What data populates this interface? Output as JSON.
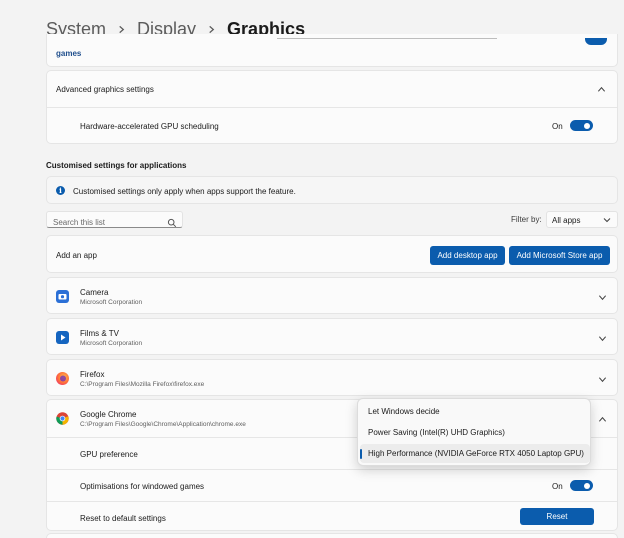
{
  "breadcrumb": {
    "items": [
      "System",
      "Display"
    ],
    "current": "Graphics"
  },
  "top_card": {
    "text": "games"
  },
  "advanced": {
    "title": "Advanced graphics settings",
    "gpu_scheduling_label": "Hardware-accelerated GPU scheduling",
    "gpu_scheduling_state": "On",
    "gpu_scheduling_enabled": true
  },
  "custom": {
    "section_title": "Customised settings for applications",
    "info_text": "Customised settings only apply when apps support the feature."
  },
  "search": {
    "placeholder": "Search this list"
  },
  "filter": {
    "label": "Filter by:",
    "value": "All apps"
  },
  "add_app": {
    "label": "Add an app",
    "desktop_button": "Add desktop app",
    "store_button": "Add Microsoft Store app"
  },
  "apps": [
    {
      "name": "Camera",
      "publisher": "Microsoft Corporation",
      "icon": "camera-icon"
    },
    {
      "name": "Films & TV",
      "publisher": "Microsoft Corporation",
      "icon": "films-tv-icon"
    },
    {
      "name": "Firefox",
      "publisher": "C:\\Program Files\\Mozilla Firefox\\firefox.exe",
      "icon": "firefox-icon"
    },
    {
      "name": "Google Chrome",
      "publisher": "C:\\Program Files\\Google\\Chrome\\Application\\chrome.exe",
      "icon": "chrome-icon"
    }
  ],
  "chrome_settings": {
    "gpu_pref_label": "GPU preference",
    "windowed_label": "Optimisations for windowed games",
    "windowed_state": "On",
    "windowed_enabled": true,
    "reset_label": "Reset to default settings",
    "reset_button": "Reset"
  },
  "gpu_dropdown": {
    "options": [
      "Let Windows decide",
      "Power Saving (Intel(R) UHD Graphics)",
      "High Performance (NVIDIA GeForce RTX 4050 Laptop GPU)"
    ],
    "selected": "High Performance (NVIDIA GeForce RTX 4050 Laptop GPU)"
  },
  "colors": {
    "accent": "#0b5cad",
    "background": "#f3f3f3",
    "card": "#fbfbfb"
  }
}
